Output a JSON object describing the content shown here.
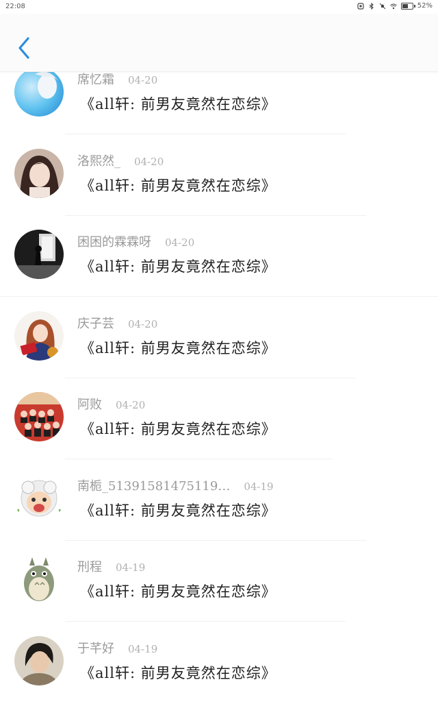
{
  "status": {
    "time": "22:08",
    "battery": "52%"
  },
  "header": {
    "back_icon": "chevron-left-icon",
    "accent": "#2a8de0"
  },
  "comments": [
    {
      "name": "席忆霜",
      "date": "04-20",
      "text": "《all轩:  前男友竟然在恋综》",
      "avatar": "avatar-blue"
    },
    {
      "name": "洛熙然_",
      "date": "04-20",
      "text": "《all轩:  前男友竟然在恋综》",
      "avatar": "avatar-girl"
    },
    {
      "name": "困困的霖霖呀",
      "date": "04-20",
      "text": "《all轩:  前男友竟然在恋综》",
      "avatar": "avatar-dark"
    },
    {
      "name": "庆子芸",
      "date": "04-20",
      "text": "《all轩:  前男友竟然在恋综》",
      "avatar": "avatar-anime"
    },
    {
      "name": "阿败",
      "date": "04-20",
      "text": "《all轩:  前男友竟然在恋综》",
      "avatar": "avatar-group"
    },
    {
      "name": "南栀_51391581475119…",
      "date": "04-19",
      "text": "《all轩:  前男友竟然在恋综》",
      "avatar": "avatar-sheep"
    },
    {
      "name": "刑程",
      "date": "04-19",
      "text": "《all轩:  前男友竟然在恋综》",
      "avatar": "avatar-totoro"
    },
    {
      "name": "于芊好",
      "date": "04-19",
      "text": "《all轩:  前男友竟然在恋综》",
      "avatar": "avatar-boy"
    }
  ]
}
